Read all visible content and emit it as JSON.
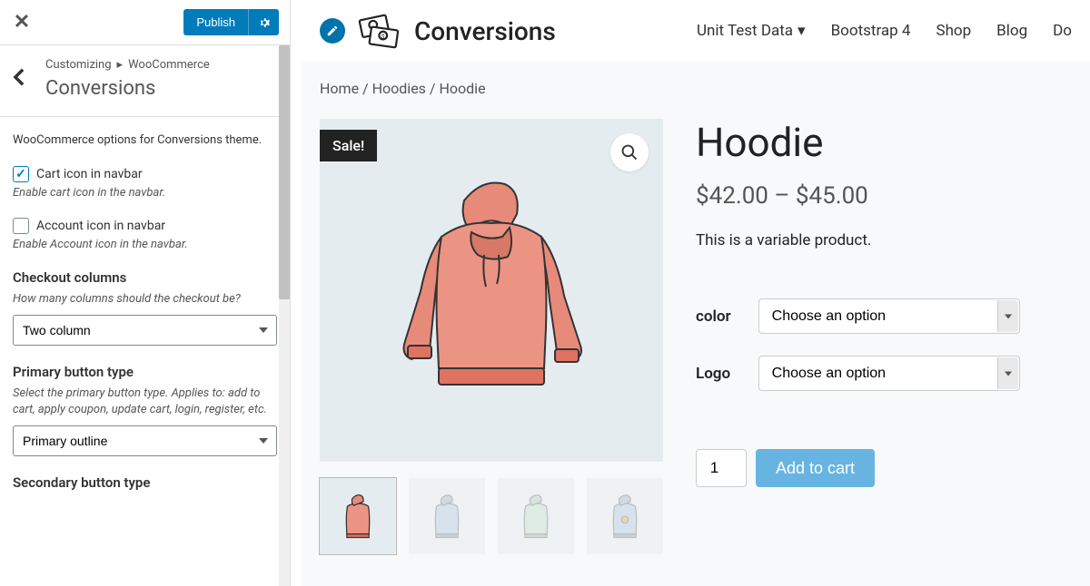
{
  "sidebar": {
    "publish_label": "Publish",
    "breadcrumb_prefix": "Customizing",
    "breadcrumb_parent": "WooCommerce",
    "current_section": "Conversions",
    "intro": "WooCommerce options for Conversions theme.",
    "cart_icon": {
      "label": "Cart icon in navbar",
      "desc": "Enable cart icon in the navbar.",
      "checked": true
    },
    "account_icon": {
      "label": "Account icon in navbar",
      "desc": "Enable Account icon in the navbar.",
      "checked": false
    },
    "checkout_columns": {
      "label": "Checkout columns",
      "desc": "How many columns should the checkout be?",
      "value": "Two column"
    },
    "primary_button": {
      "label": "Primary button type",
      "desc": "Select the primary button type. Applies to: add to cart, apply coupon, update cart, login, register, etc.",
      "value": "Primary outline"
    },
    "secondary_button": {
      "label": "Secondary button type"
    }
  },
  "preview": {
    "brand": "Conversions",
    "nav": {
      "item1": "Unit Test Data",
      "item2": "Bootstrap 4",
      "item3": "Shop",
      "item4": "Blog",
      "item5": "Do"
    },
    "breadcrumb": {
      "home": "Home",
      "cat": "Hoodies",
      "current": "Hoodie"
    },
    "sale_badge": "Sale!",
    "product": {
      "title": "Hoodie",
      "price": "$42.00 – $45.00",
      "desc": "This is a variable product.",
      "var1_label": "color",
      "var2_label": "Logo",
      "option_placeholder": "Choose an option",
      "qty": "1",
      "add_to_cart": "Add to cart"
    }
  }
}
